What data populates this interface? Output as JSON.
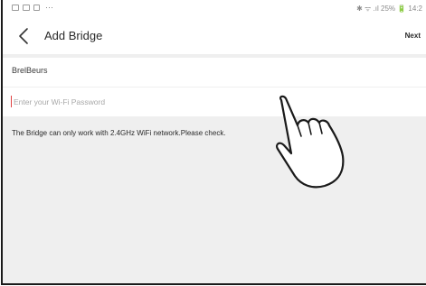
{
  "status_bar": {
    "left_icons": [
      "image-icon",
      "gallery-icon",
      "square-icon"
    ],
    "more": "···",
    "right_text": "✱ ᯤ .ıl 25% 🔋 14:2"
  },
  "header": {
    "title": "Add Bridge",
    "next_label": "Next"
  },
  "form": {
    "ssid": "BrelBeurs",
    "password_value": "",
    "password_placeholder": "Enter your Wi-Fi Password",
    "note": "The Bridge can only work with 2.4GHz WiFi network.Please check."
  }
}
